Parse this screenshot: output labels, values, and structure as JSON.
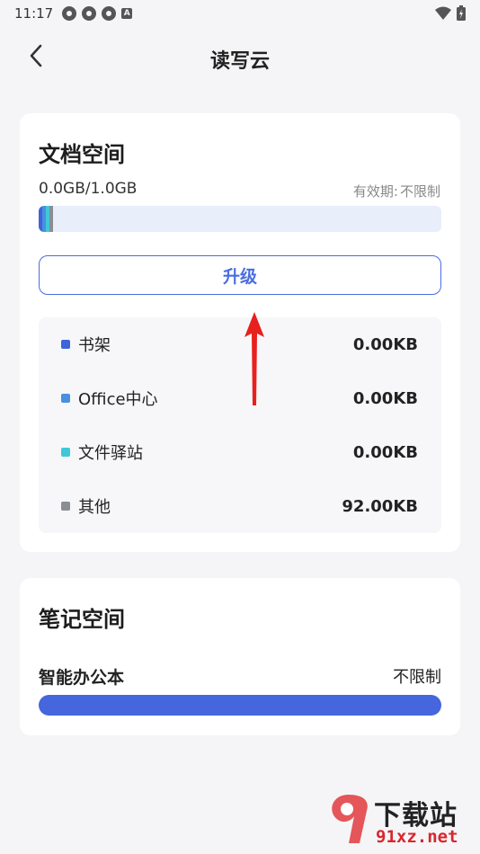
{
  "status_bar": {
    "time": "11:17"
  },
  "header": {
    "title": "读写云"
  },
  "doc_space": {
    "title": "文档空间",
    "usage": "0.0GB/1.0GB",
    "validity_label": "有效期:",
    "validity_value": "不限制",
    "upgrade_label": "升级",
    "items": [
      {
        "label": "书架",
        "value": "0.00KB",
        "color": "#3f63d8"
      },
      {
        "label": "Office中心",
        "value": "0.00KB",
        "color": "#4a8fe0"
      },
      {
        "label": "文件驿站",
        "value": "0.00KB",
        "color": "#3fc8d8"
      },
      {
        "label": "其他",
        "value": "92.00KB",
        "color": "#8a8d92"
      }
    ]
  },
  "note_space": {
    "title": "笔记空间",
    "item_label": "智能办公本",
    "item_value": "不限制"
  },
  "watermark": {
    "top": "下载站",
    "bottom": "91xz.net"
  },
  "colors": {
    "accent": "#4a6ee0",
    "annotation": "#e8201e",
    "background": "#f5f5f7"
  }
}
